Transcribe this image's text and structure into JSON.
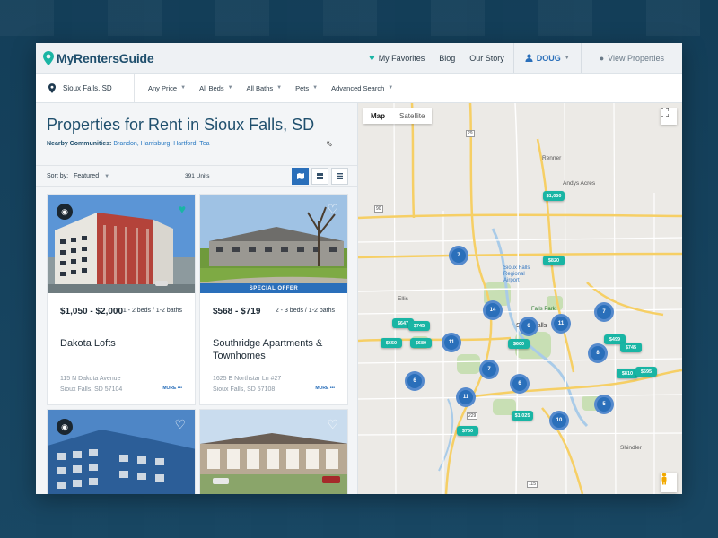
{
  "header": {
    "logo": "MyRentersGuide",
    "favorites": "My Favorites",
    "blog": "Blog",
    "story": "Our Story",
    "user": "DOUG",
    "view": "View Properties"
  },
  "filters": {
    "location": "Sioux Falls, SD",
    "price": "Any Price",
    "beds": "All Beds",
    "baths": "All Baths",
    "pets": "Pets",
    "advanced": "Advanced Search"
  },
  "listing": {
    "title": "Properties for Rent in Sioux Falls, SD",
    "nearby_label": "Nearby Communities:",
    "nearby_links": "Brandon, Harrisburg, Hartford, Tea",
    "sort_label": "Sort by:",
    "sort_value": "Featured",
    "units": "391 Units"
  },
  "cards": [
    {
      "price": "$1,050 - $2,000",
      "beds": "1 - 2 beds / 1-2 baths",
      "name": "Dakota Lofts",
      "addr1": "115 N Dakota Avenue",
      "addr2": "Sioux Falls, SD 57104",
      "more": "MORE •••",
      "favorited": true
    },
    {
      "price": "$568 - $719",
      "beds": "2 - 3 beds / 1-2 baths",
      "name": "Southridge Apartments & Townhomes",
      "addr1": "1625 E Northstar Ln #27",
      "addr2": "Sioux Falls, SD 57108",
      "more": "MORE •••",
      "special": "SPECIAL OFFER",
      "favorited": false
    }
  ],
  "map": {
    "tab_map": "Map",
    "tab_sat": "Satellite",
    "labels": {
      "renner": "Renner",
      "andys": "Andys Acres",
      "airport": "Sioux Falls Regional Airport",
      "ellis": "Ellis",
      "fallspark": "Falls Park",
      "city": "Sioux Falls",
      "shindler": "Shindler",
      "rd115": "115",
      "rd229": "229",
      "rd29": "29",
      "rd90": "90"
    },
    "clusters": [
      {
        "count": "7"
      },
      {
        "count": "14"
      },
      {
        "count": "11"
      },
      {
        "count": "6"
      },
      {
        "count": "7"
      },
      {
        "count": "11"
      },
      {
        "count": "6"
      },
      {
        "count": "7"
      },
      {
        "count": "11"
      },
      {
        "count": "6"
      },
      {
        "count": "10"
      },
      {
        "count": "8"
      },
      {
        "count": "5"
      }
    ],
    "price_pins": [
      {
        "price": "$1,050"
      },
      {
        "price": "$820"
      },
      {
        "price": "$647"
      },
      {
        "price": "$745"
      },
      {
        "price": "$650"
      },
      {
        "price": "$680"
      },
      {
        "price": "$499"
      },
      {
        "price": "$745"
      },
      {
        "price": "$810"
      },
      {
        "price": "$595"
      },
      {
        "price": "$600"
      },
      {
        "price": "$1,025"
      },
      {
        "price": "$750"
      }
    ]
  }
}
